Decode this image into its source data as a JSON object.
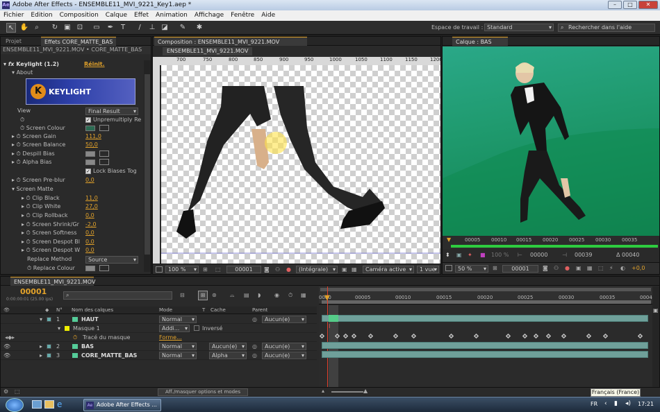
{
  "window": {
    "title": "Adobe After Effects - ENSEMBLE11_MVI_9221_Key1.aep *"
  },
  "menu": [
    "Fichier",
    "Edition",
    "Composition",
    "Calque",
    "Effet",
    "Animation",
    "Affichage",
    "Fenêtre",
    "Aide"
  ],
  "workspace": {
    "label": "Espace de travail :",
    "value": "Standard",
    "search_placeholder": "Rechercher dans l'aide"
  },
  "effects_panel": {
    "tab_project": "Projet",
    "tab_effects": "Effets CORE_MATTE_BAS",
    "subtitle": "ENSEMBLE11_MVI_9221.MOV • CORE_MATTE_BAS",
    "effect_name": "Keylight (1.2)",
    "reset": "Réinit.",
    "about": "About",
    "logo_text": "KEYLIGHT",
    "params": [
      {
        "label": "View",
        "value": "Final Result",
        "kind": "dropdown"
      },
      {
        "label": "",
        "value": "Unpremultiply Re",
        "kind": "check"
      },
      {
        "label": "Screen Colour",
        "value": "",
        "kind": "color"
      },
      {
        "label": "Screen Gain",
        "value": "111,0",
        "kind": "num"
      },
      {
        "label": "Screen Balance",
        "value": "50,0",
        "kind": "num"
      },
      {
        "label": "Despill Bias",
        "value": "",
        "kind": "color"
      },
      {
        "label": "Alpha Bias",
        "value": "",
        "kind": "color"
      },
      {
        "label": "",
        "value": "Lock Biases Tog",
        "kind": "check"
      },
      {
        "label": "Screen Pre-blur",
        "value": "0,0",
        "kind": "num"
      },
      {
        "label": "Screen Matte",
        "value": "",
        "kind": "group"
      },
      {
        "label": "Clip Black",
        "value": "11,0",
        "kind": "num"
      },
      {
        "label": "Clip White",
        "value": "27,0",
        "kind": "num"
      },
      {
        "label": "Clip Rollback",
        "value": "0,0",
        "kind": "num"
      },
      {
        "label": "Screen Shrink/Gr",
        "value": "-2,0",
        "kind": "num"
      },
      {
        "label": "Screen Softness",
        "value": "0,0",
        "kind": "num"
      },
      {
        "label": "Screen Despot Bl",
        "value": "0,0",
        "kind": "num"
      },
      {
        "label": "Screen Despot W",
        "value": "0,0",
        "kind": "num"
      },
      {
        "label": "Replace Method",
        "value": "Source",
        "kind": "dropdown"
      },
      {
        "label": "Replace Colour",
        "value": "",
        "kind": "color"
      }
    ]
  },
  "comp_panel": {
    "tab": "Composition : ENSEMBLE11_MVI_9221.MOV",
    "subtab": "ENSEMBLE11_MVI_9221.MOV",
    "ruler": [
      "700",
      "750",
      "800",
      "850",
      "900",
      "950",
      "1000",
      "1050",
      "1100",
      "1150",
      "1200"
    ],
    "zoom": "100 %",
    "frame": "00001",
    "resolution": "(Intégrale)",
    "camera": "Caméra active",
    "views": "1 vue"
  },
  "layer_panel": {
    "tab": "Calque : BAS",
    "ruler": [
      "00005",
      "00010",
      "00015",
      "00020",
      "00025",
      "00030",
      "00035"
    ],
    "zoom": "50 %",
    "frame": "00001",
    "in": "00000",
    "out": "00039",
    "delta": "Δ 00040",
    "exposure": "+0,0",
    "percent": "100 %"
  },
  "timeline": {
    "tab": "ENSEMBLE11_MVI_9221.MOV",
    "timecode": "00001",
    "timecode_sub": "0:00:00:01 (25.00 ips)",
    "headers": {
      "num": "N°",
      "name": "Nom des calques",
      "mode": "Mode",
      "t": "T",
      "cache": "Cache",
      "parent": "Parent"
    },
    "ruler": [
      "00005",
      "00010",
      "00015",
      "00020",
      "00025",
      "00030",
      "00035",
      "0004"
    ],
    "layers": [
      {
        "num": "1",
        "name": "HAUT",
        "mode": "Normal",
        "cache": "",
        "parent": "Aucun(e)"
      },
      {
        "num": "",
        "name": "Masque 1",
        "mode": "Addi...",
        "cache": "Inversé",
        "parent": ""
      },
      {
        "num": "",
        "name": "Tracé du masque",
        "mode": "Forme...",
        "cache": "",
        "parent": ""
      },
      {
        "num": "2",
        "name": "BAS",
        "mode": "Normal",
        "cache": "Aucun(e)",
        "parent": "Aucun(e)"
      },
      {
        "num": "3",
        "name": "CORE_MATTE_BAS",
        "mode": "Normal",
        "cache": "Alpha",
        "parent": "Aucun(e)"
      }
    ],
    "toggle_label": "Aff./masquer options et modes"
  },
  "tooltip": "Français (France)",
  "taskbar": {
    "app": "Adobe After Effects ...",
    "lang": "FR",
    "time": "17:21"
  },
  "colors": {
    "accent": "#e2a22a",
    "green_screen": "#1f9a6e",
    "bar": "#6fa09a",
    "cti": "#e0402c"
  }
}
